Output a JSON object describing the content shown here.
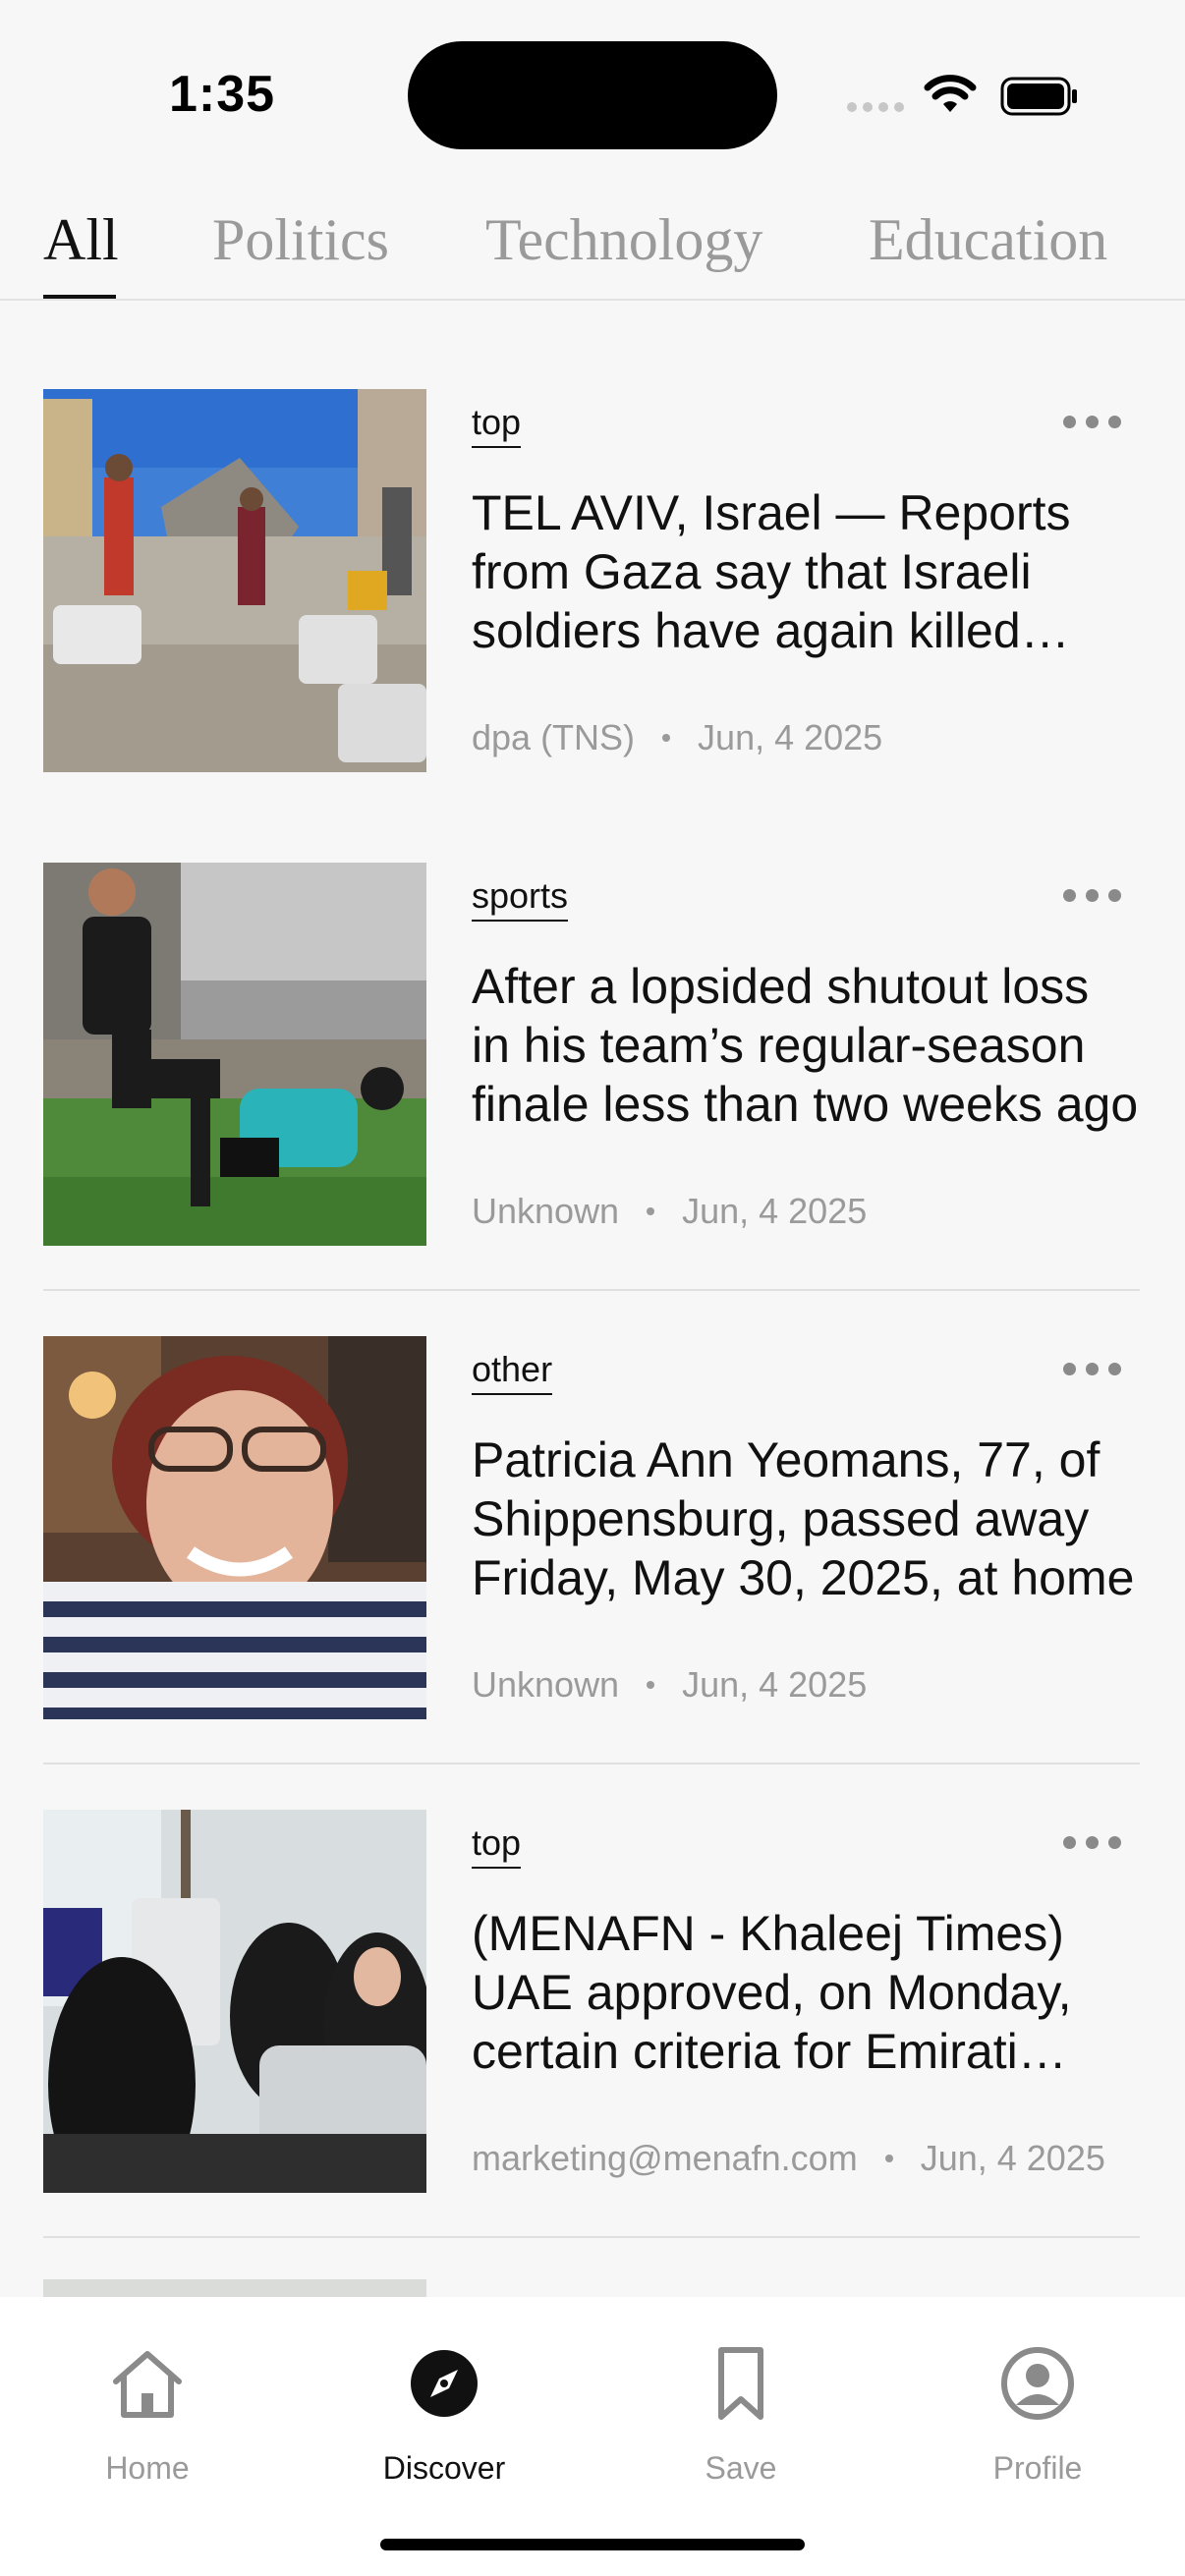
{
  "status_bar": {
    "time": "1:35",
    "icons": [
      "cellular-signal-icon",
      "wifi-icon",
      "battery-icon"
    ]
  },
  "tabs": [
    {
      "label": "All",
      "active": true
    },
    {
      "label": "Politics",
      "active": false
    },
    {
      "label": "Technology",
      "active": false
    },
    {
      "label": "Education",
      "active": false
    }
  ],
  "articles": [
    {
      "category": "top",
      "headline": "TEL AVIV, Israel — Reports from Gaza say that Israeli soldiers have again killed Palestinians",
      "source": "dpa (TNS)",
      "date": "Jun, 4 2025"
    },
    {
      "category": "sports",
      "headline": "After a lopsided shutout loss in his team’s regular-season finale less than two weeks ago",
      "source": "Unknown",
      "date": "Jun, 4 2025"
    },
    {
      "category": "other",
      "headline": "Patricia Ann Yeomans, 77, of Shippensburg, passed away Friday, May 30, 2025, at home",
      "source": "Unknown",
      "date": "Jun, 4 2025"
    },
    {
      "category": "top",
      "headline": "(MENAFN - Khaleej Times) UAE approved, on Monday, certain criteria for Emirati students",
      "source": "marketing@menafn.com",
      "date": "Jun, 4 2025"
    }
  ],
  "bottom_nav": [
    {
      "label": "Home",
      "icon": "home-icon",
      "active": false
    },
    {
      "label": "Discover",
      "icon": "compass-icon",
      "active": true
    },
    {
      "label": "Save",
      "icon": "bookmark-icon",
      "active": false
    },
    {
      "label": "Profile",
      "icon": "profile-icon",
      "active": false
    }
  ],
  "colors": {
    "background": "#f7f7f7",
    "text_primary": "#111111",
    "text_secondary": "#9a9a9a",
    "divider": "#e0e0e0"
  }
}
